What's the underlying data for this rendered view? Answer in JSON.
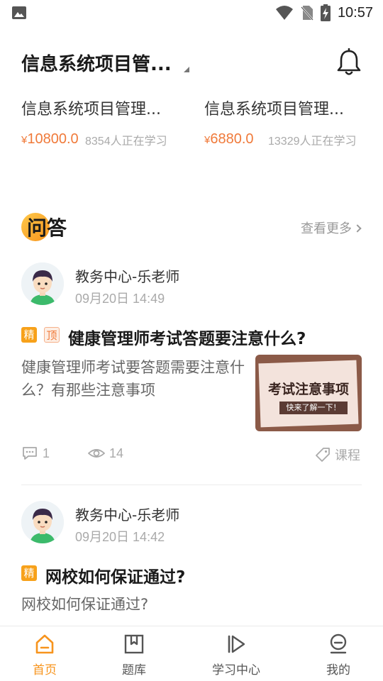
{
  "status_bar": {
    "time": "10:57"
  },
  "header": {
    "title": "信息系统项目管..."
  },
  "courses": [
    {
      "name": "信息系统项目管理...",
      "currency": "¥",
      "price": "10800.0",
      "learners": "8354人正在学习"
    },
    {
      "name": "信息系统项目管理...",
      "currency": "¥",
      "price": "6880.0",
      "learners": "13329人正在学习"
    }
  ],
  "qa": {
    "heading": "问答",
    "see_more": "查看更多"
  },
  "posts": [
    {
      "author": "教务中心-乐老师",
      "time": "09月20日 14:49",
      "tags": [
        "精",
        "顶"
      ],
      "title": "健康管理师考试答题要注意什么?",
      "body": "健康管理师考试要答题需要注意什么？有那些注意事项",
      "thumbnail": {
        "title": "考试注意事项",
        "subtitle": "快来了解一下！"
      },
      "comments": "1",
      "views": "14",
      "category": "课程"
    },
    {
      "author": "教务中心-乐老师",
      "time": "09月20日 14:42",
      "tags": [
        "精"
      ],
      "title": "网校如何保证通过?",
      "body": "网校如何保证通过?"
    }
  ],
  "bottom_nav": [
    {
      "label": "首页",
      "icon": "home-icon",
      "active": true
    },
    {
      "label": "题库",
      "icon": "bookmark-book-icon",
      "active": false
    },
    {
      "label": "学习中心",
      "icon": "play-icon",
      "active": false
    },
    {
      "label": "我的",
      "icon": "profile-icon",
      "active": false
    }
  ],
  "colors": {
    "accent": "#f7941d",
    "price": "#f07a3a",
    "muted": "#aaaaaa"
  }
}
